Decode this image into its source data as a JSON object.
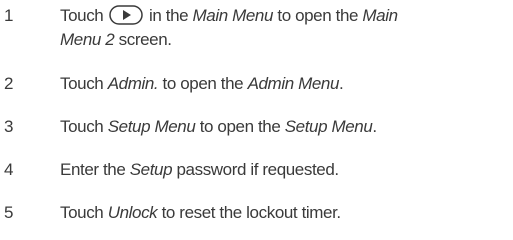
{
  "steps": [
    {
      "number": "1",
      "parts": [
        "Touch",
        "in the",
        "Main Menu",
        "to open the",
        "Main",
        "Menu 2",
        "screen."
      ]
    },
    {
      "number": "2",
      "parts": [
        "Touch",
        "Admin.",
        "to open the",
        "Admin Menu",
        "."
      ]
    },
    {
      "number": "3",
      "parts": [
        "Touch",
        "Setup Menu",
        "to open the",
        "Setup Menu",
        "."
      ]
    },
    {
      "number": "4",
      "parts": [
        "Enter the",
        "Setup",
        "password if requested."
      ]
    },
    {
      "number": "5",
      "parts": [
        "Touch",
        "Unlock",
        "to reset the lockout timer."
      ]
    }
  ],
  "icons": {
    "step1": "play-forward-button-icon"
  },
  "colors": {
    "text": "#3a3a3a",
    "icon_stroke": "#3a3a3a"
  }
}
